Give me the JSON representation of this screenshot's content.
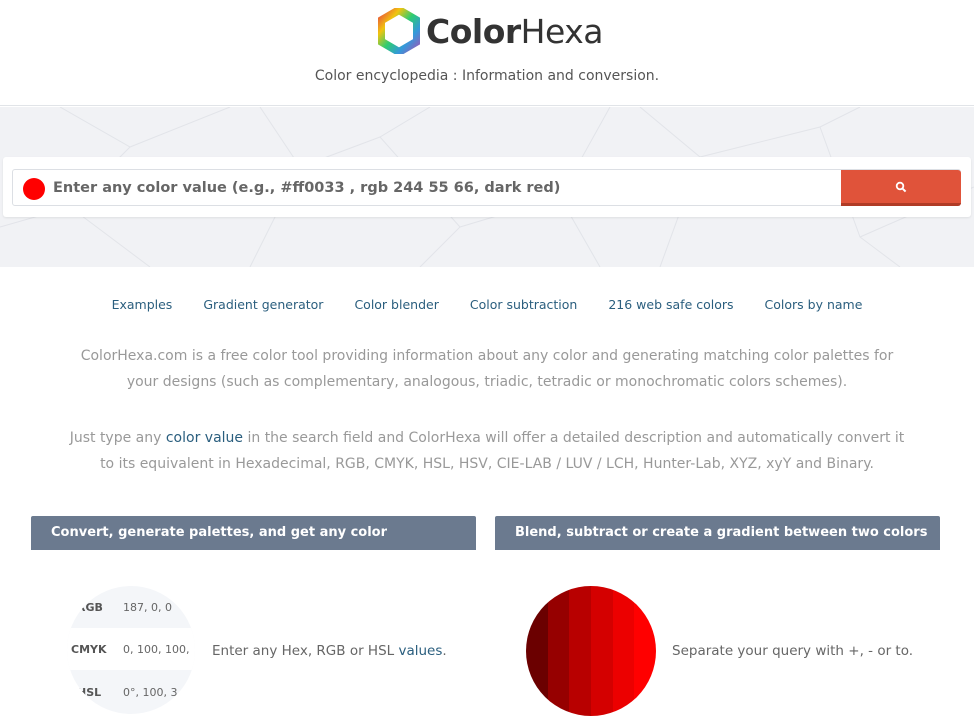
{
  "brand": {
    "name_bold": "Color",
    "name_light": "Hexa",
    "tagline": "Color encyclopedia : Information and conversion."
  },
  "search": {
    "placeholder": "Enter any color value (e.g., #ff0033 , rgb 244 55 66, dark red)",
    "swatch_color": "#ff0000",
    "button_color": "#e0533a",
    "button_icon": "search-icon"
  },
  "nav": {
    "items": [
      {
        "label": "Examples"
      },
      {
        "label": "Gradient generator"
      },
      {
        "label": "Color blender"
      },
      {
        "label": "Color subtraction"
      },
      {
        "label": "216 web safe colors"
      },
      {
        "label": "Colors by name"
      }
    ]
  },
  "intro": {
    "p1": "ColorHexa.com is a free color tool providing information about any color and generating matching color palettes for your designs (such as complementary, analogous, triadic, tetradic or monochromatic colors schemes).",
    "p2_before": "Just type any ",
    "p2_link": "color value",
    "p2_after": " in the search field and ColorHexa will offer a detailed description and automatically convert it to its equivalent in Hexadecimal, RGB, CMYK, HSL, HSV, CIE-LAB / LUV / LCH, Hunter-Lab, XYZ, xyY and Binary."
  },
  "sections": {
    "convert": {
      "title": "Convert, generate palettes, and get any color information",
      "table": [
        {
          "key": "RGB",
          "value": "187, 0, 0"
        },
        {
          "key": "CMYK",
          "value": "0, 100, 100,"
        },
        {
          "key": "HSL",
          "value": "0°, 100, 3"
        }
      ],
      "caption_before": "Enter any Hex, RGB or HSL ",
      "caption_link": "values",
      "caption_after": "."
    },
    "blend": {
      "title": "Blend, subtract or create a gradient between two colors",
      "stripes": [
        "#6b0000",
        "#960000",
        "#b80000",
        "#d40000",
        "#ec0000",
        "#ff0000"
      ],
      "caption": "Separate your query with +, - or to."
    }
  }
}
